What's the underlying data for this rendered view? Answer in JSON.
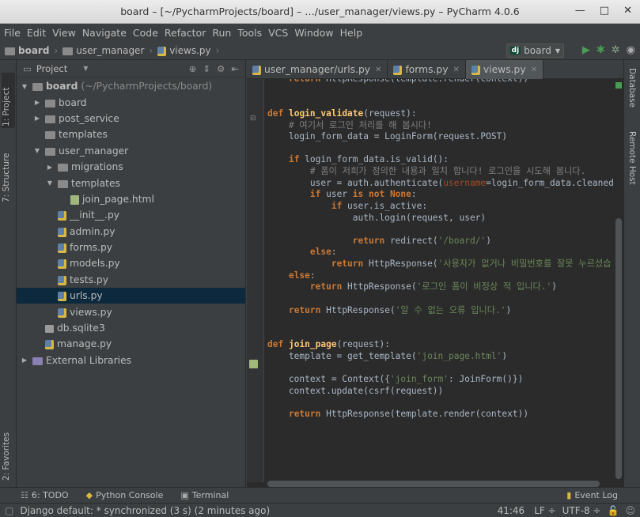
{
  "window": {
    "title": "board – [~/PycharmProjects/board] – …/user_manager/views.py – PyCharm 4.0.6"
  },
  "menu": [
    "File",
    "Edit",
    "View",
    "Navigate",
    "Code",
    "Refactor",
    "Run",
    "Tools",
    "VCS",
    "Window",
    "Help"
  ],
  "breadcrumb": {
    "root": "board",
    "folder": "user_manager",
    "file": "views.py"
  },
  "run_config": {
    "badge": "dj",
    "name": "board"
  },
  "left_tabs": {
    "project": "1: Project",
    "structure": "7: Structure",
    "favorites": "2: Favorites"
  },
  "right_tabs": {
    "database": "Database",
    "remote": "Remote Host"
  },
  "project_panel": {
    "header": "Project",
    "tree": [
      {
        "label": "board",
        "extra": "(~/PycharmProjects/board)",
        "indent": 0,
        "type": "root-folder",
        "arrow": "open"
      },
      {
        "label": "board",
        "indent": 1,
        "type": "folder",
        "arrow": "closed"
      },
      {
        "label": "post_service",
        "indent": 1,
        "type": "folder",
        "arrow": "closed"
      },
      {
        "label": "templates",
        "indent": 1,
        "type": "folder",
        "arrow": "none"
      },
      {
        "label": "user_manager",
        "indent": 1,
        "type": "folder",
        "arrow": "open"
      },
      {
        "label": "migrations",
        "indent": 2,
        "type": "folder",
        "arrow": "closed"
      },
      {
        "label": "templates",
        "indent": 2,
        "type": "folder",
        "arrow": "open"
      },
      {
        "label": "join_page.html",
        "indent": 3,
        "type": "html",
        "arrow": "none"
      },
      {
        "label": "__init__.py",
        "indent": 2,
        "type": "py",
        "arrow": "none"
      },
      {
        "label": "admin.py",
        "indent": 2,
        "type": "py",
        "arrow": "none"
      },
      {
        "label": "forms.py",
        "indent": 2,
        "type": "py",
        "arrow": "none"
      },
      {
        "label": "models.py",
        "indent": 2,
        "type": "py",
        "arrow": "none"
      },
      {
        "label": "tests.py",
        "indent": 2,
        "type": "py",
        "arrow": "none"
      },
      {
        "label": "urls.py",
        "indent": 2,
        "type": "py",
        "arrow": "none",
        "selected": true
      },
      {
        "label": "views.py",
        "indent": 2,
        "type": "py",
        "arrow": "none"
      },
      {
        "label": "db.sqlite3",
        "indent": 1,
        "type": "db",
        "arrow": "none"
      },
      {
        "label": "manage.py",
        "indent": 1,
        "type": "py",
        "arrow": "none"
      },
      {
        "label": "External Libraries",
        "indent": 0,
        "type": "lib",
        "arrow": "closed"
      }
    ]
  },
  "editor_tabs": [
    {
      "label": "user_manager/urls.py",
      "active": false
    },
    {
      "label": "forms.py",
      "active": false
    },
    {
      "label": "views.py",
      "active": true
    }
  ],
  "code_lines": [
    [
      {
        "t": "    "
      },
      {
        "t": "return",
        "c": "kw"
      },
      {
        "t": " HttpResponse(template.render(context))"
      }
    ],
    [
      {
        "t": ""
      }
    ],
    [
      {
        "t": ""
      }
    ],
    [
      {
        "t": "def",
        "c": "kw"
      },
      {
        "t": " "
      },
      {
        "t": "login_validate",
        "c": "fn"
      },
      {
        "t": "(request):"
      }
    ],
    [
      {
        "t": "    # 여기서 로그인 처리를 해 봅시다!",
        "c": "cm"
      }
    ],
    [
      {
        "t": "    login_form_data = LoginForm(request.POST)"
      }
    ],
    [
      {
        "t": ""
      }
    ],
    [
      {
        "t": "    "
      },
      {
        "t": "if",
        "c": "kw"
      },
      {
        "t": " login_form_data.is_valid():"
      }
    ],
    [
      {
        "t": "        # 폼이 저희가 정의한 내용과 일치 합니다! 로그인을 시도해 봅니다.",
        "c": "cm"
      }
    ],
    [
      {
        "t": "        user = auth.authenticate("
      },
      {
        "t": "username",
        "c": "param"
      },
      {
        "t": "=login_form_data.cleaned_d"
      }
    ],
    [
      {
        "t": "        "
      },
      {
        "t": "if",
        "c": "kw"
      },
      {
        "t": " user "
      },
      {
        "t": "is not None",
        "c": "kw"
      },
      {
        "t": ":"
      }
    ],
    [
      {
        "t": "            "
      },
      {
        "t": "if",
        "c": "kw"
      },
      {
        "t": " user.is_active:"
      }
    ],
    [
      {
        "t": "                auth.login(request, user)"
      }
    ],
    [
      {
        "t": ""
      }
    ],
    [
      {
        "t": "                "
      },
      {
        "t": "return",
        "c": "kw"
      },
      {
        "t": " redirect("
      },
      {
        "t": "'/board/'",
        "c": "str"
      },
      {
        "t": ")"
      }
    ],
    [
      {
        "t": "        "
      },
      {
        "t": "else",
        "c": "kw"
      },
      {
        "t": ":"
      }
    ],
    [
      {
        "t": "            "
      },
      {
        "t": "return",
        "c": "kw"
      },
      {
        "t": " HttpResponse("
      },
      {
        "t": "'사용자가 없거나 비밀번호를 잘못 누르셨습",
        "c": "str"
      }
    ],
    [
      {
        "t": "    "
      },
      {
        "t": "else",
        "c": "kw"
      },
      {
        "t": ":"
      }
    ],
    [
      {
        "t": "        "
      },
      {
        "t": "return",
        "c": "kw"
      },
      {
        "t": " HttpResponse("
      },
      {
        "t": "'로그인 폼이 비정상 적 입니다.'",
        "c": "str"
      },
      {
        "t": ")"
      }
    ],
    [
      {
        "t": ""
      }
    ],
    [
      {
        "t": "    "
      },
      {
        "t": "return",
        "c": "kw"
      },
      {
        "t": " HttpResponse("
      },
      {
        "t": "'알 수 없는 오류 입니다.'",
        "c": "str"
      },
      {
        "t": ")"
      }
    ],
    [
      {
        "t": ""
      }
    ],
    [
      {
        "t": ""
      }
    ],
    [
      {
        "t": "def",
        "c": "kw"
      },
      {
        "t": " "
      },
      {
        "t": "join_page",
        "c": "fn"
      },
      {
        "t": "(request):"
      }
    ],
    [
      {
        "t": "    template = get_template("
      },
      {
        "t": "'join_page.html'",
        "c": "str"
      },
      {
        "t": ")"
      }
    ],
    [
      {
        "t": ""
      }
    ],
    [
      {
        "t": "    context = Context({"
      },
      {
        "t": "'join_form'",
        "c": "str"
      },
      {
        "t": ": JoinForm()})"
      }
    ],
    [
      {
        "t": "    context.update(csrf(request))"
      }
    ],
    [
      {
        "t": ""
      }
    ],
    [
      {
        "t": "    "
      },
      {
        "t": "return",
        "c": "kw"
      },
      {
        "t": " HttpResponse(template.render(context))"
      }
    ]
  ],
  "bottom_tools": {
    "todo": "6: TODO",
    "console": "Python Console",
    "terminal": "Terminal",
    "event_log": "Event Log"
  },
  "status": {
    "message": "Django default: * synchronized (3 s) (2 minutes ago)",
    "position": "41:46",
    "line_sep": "LF ÷",
    "encoding": "UTF-8 ÷"
  }
}
